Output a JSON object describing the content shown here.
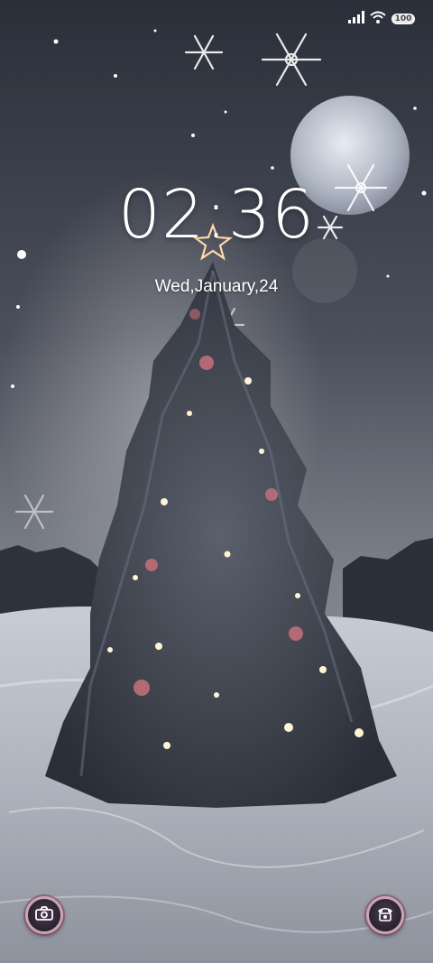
{
  "status_bar": {
    "battery_level": "100",
    "signal_icon": "signal-bars-icon",
    "wifi_icon": "wifi-icon"
  },
  "lockscreen": {
    "time": "02:36",
    "date": "Wed,January,24"
  },
  "shortcuts": {
    "left_icon": "camera-icon",
    "right_icon": "phone-icon"
  },
  "colors": {
    "sky_top": "#2f3340",
    "sky_mid": "#6a6e78",
    "snow": "#dfe3ea",
    "tree": "#3a3f4a",
    "shortcut_ring": "#c9a5b6"
  }
}
